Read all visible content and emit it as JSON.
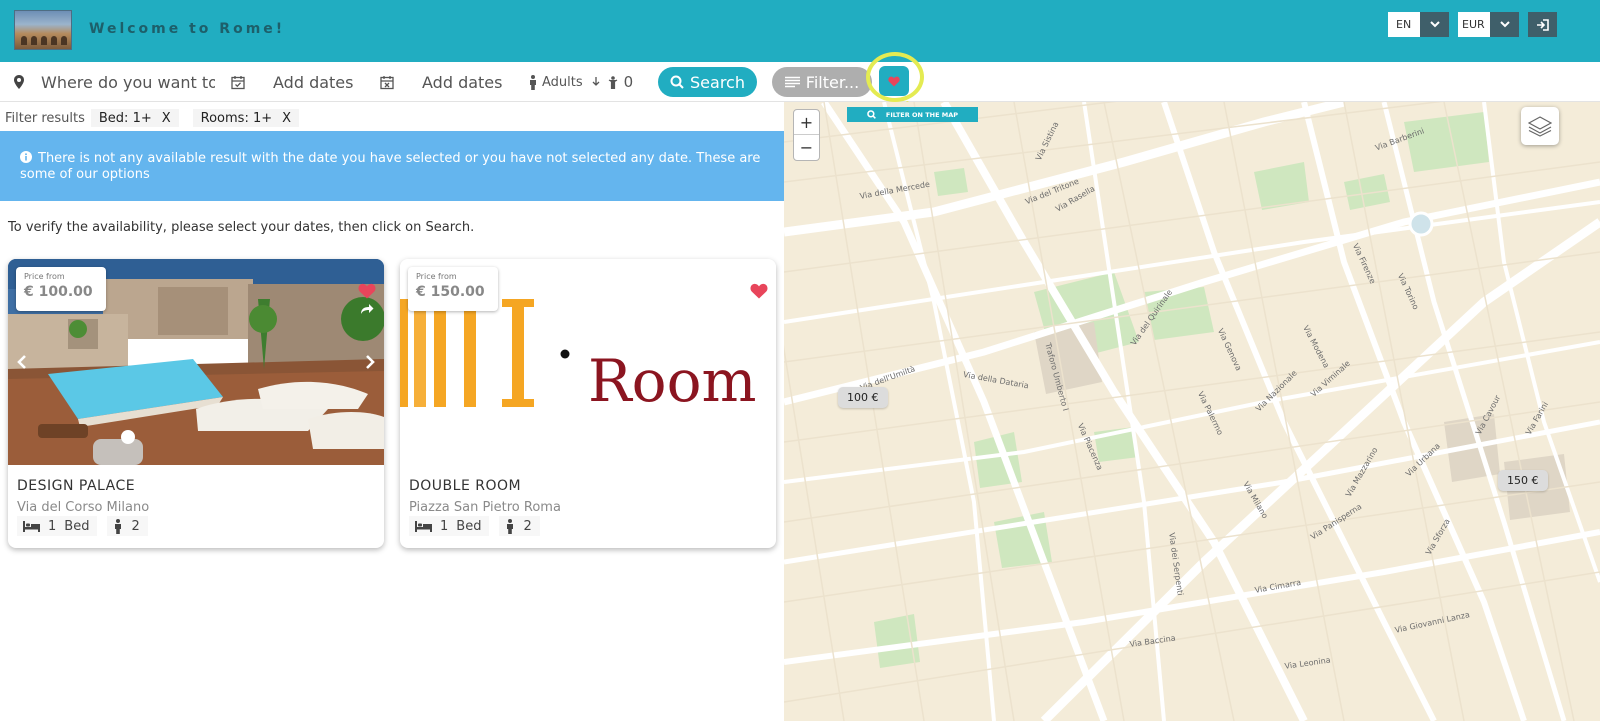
{
  "header": {
    "site_title": "Welcome to Rome!",
    "language": "EN",
    "currency": "EUR",
    "icons": {
      "dropdown": "chevron-down-icon",
      "login": "sign-in-icon",
      "logo": "colosseum-logo"
    }
  },
  "search": {
    "where_placeholder": "Where do you want to go",
    "checkin_label": "Add dates",
    "checkout_label": "Add dates",
    "guests_label": "Adults",
    "children_count": "0",
    "search_label": "Search",
    "filter_label": "Filter...",
    "icons": {
      "location": "map-pin-icon",
      "checkin": "calendar-check-icon",
      "checkout": "calendar-x-icon",
      "adult": "person-icon",
      "child": "child-icon",
      "search": "search-icon",
      "filter": "list-icon",
      "favorites": "heart-icon"
    }
  },
  "filters": {
    "label": "Filter results",
    "chips": [
      {
        "label": "Bed: 1+",
        "remove": "X"
      },
      {
        "label": "Rooms: 1+",
        "remove": "X"
      }
    ]
  },
  "notice": {
    "icon": "info-icon",
    "text": "There is not any available result with the date you have selected or you have not selected any date. These are some of our options"
  },
  "verify_text": "To verify the availability, please select your dates, then click on Search.",
  "cards": [
    {
      "price_label": "Price from",
      "price": "€ 100.00",
      "name": "DESIGN PALACE",
      "address": "Via del Corso Milano",
      "beds": "1",
      "bed_label": "Bed",
      "guests": "2",
      "favorite": true
    },
    {
      "price_label": "Price from",
      "price": "€ 150.00",
      "name": "DOUBLE ROOM",
      "address": "Piazza San Pietro Roma",
      "beds": "1",
      "bed_label": "Bed",
      "guests": "2",
      "image_text": "Room",
      "favorite": true
    }
  ],
  "map": {
    "zoom_in": "+",
    "zoom_out": "−",
    "filter_map_label": "FILTER ON THE MAP",
    "markers": [
      "100 €",
      "150 €"
    ],
    "streets": [
      "Via Barberini",
      "Via del Tritone",
      "Via Sistina",
      "Via della Mercede",
      "Traforo Umberto I",
      "Via del Quirinale",
      "Via Nazionale",
      "Via Milano",
      "Via Panisperna",
      "Via Cavour",
      "Via Giovanni Lanza",
      "Via Cimarra",
      "Via Baccina",
      "Via dei Serpenti",
      "Via della Dataria",
      "Via dell'Umiltà",
      "Via Piacenza",
      "Via Genova",
      "Via Torino",
      "Via Firenze",
      "Via Modena",
      "Via Viminale",
      "Via Urbana",
      "Via Farini",
      "Via Palermo",
      "Via Rasella",
      "Via Leonina",
      "Via Mazzarino",
      "Via Sforza"
    ]
  },
  "colors": {
    "brand": "#21adc1",
    "notice": "#64b5ee",
    "header_dark": "#3f5f6a",
    "favorite": "#e8455b",
    "highlight": "#e4eb52",
    "map_bg": "#f4ecd9"
  }
}
